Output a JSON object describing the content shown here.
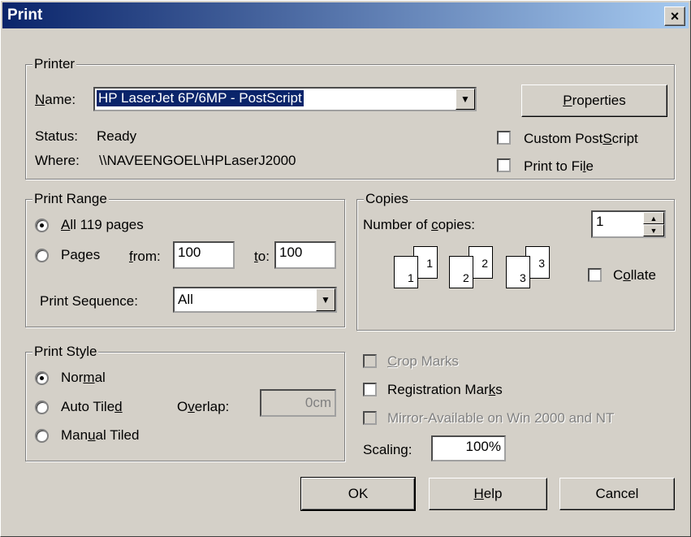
{
  "window": {
    "title": "Print",
    "close_glyph": "×"
  },
  "printer": {
    "group_label": "Printer",
    "name_label": "Name:",
    "name_value": "HP LaserJet 6P/6MP - PostScript",
    "properties_label": "Properties",
    "status_label": "Status:",
    "status_value": "Ready",
    "where_label": "Where:",
    "where_value": "\\\\NAVEENGOEL\\HPLaserJ2000",
    "custom_postscript_label": "Custom PostScript",
    "custom_postscript_checked": false,
    "print_to_file_label": "Print to File",
    "print_to_file_checked": false
  },
  "print_range": {
    "group_label": "Print Range",
    "all_label": "All 119 pages",
    "all_selected": true,
    "pages_label": "Pages",
    "from_label": "from:",
    "from_value": "100",
    "to_label": "to:",
    "to_value": "100",
    "sequence_label": "Print Sequence:",
    "sequence_value": "All"
  },
  "copies": {
    "group_label": "Copies",
    "number_label": "Number of copies:",
    "number_value": "1",
    "pages": [
      "1",
      "1",
      "2",
      "2",
      "3",
      "3"
    ],
    "collate_label": "Collate",
    "collate_checked": false
  },
  "print_style": {
    "group_label": "Print Style",
    "normal_label": "Normal",
    "auto_tiled_label": "Auto Tiled",
    "overlap_label": "Overlap:",
    "overlap_value": "0cm",
    "manual_tiled_label": "Manual Tiled",
    "selected": "Normal"
  },
  "options": {
    "crop_marks_label": "Crop Marks",
    "registration_marks_label": "Registration Marks",
    "mirror_label": "Mirror-Available on Win 2000 and NT",
    "scaling_label": "Scaling:",
    "scaling_value": "100%"
  },
  "buttons": {
    "ok": "OK",
    "help": "Help",
    "cancel": "Cancel"
  },
  "colors": {
    "titlebar": "#0a246a",
    "face": "#d4d0c8",
    "selection": "#0a246a"
  }
}
